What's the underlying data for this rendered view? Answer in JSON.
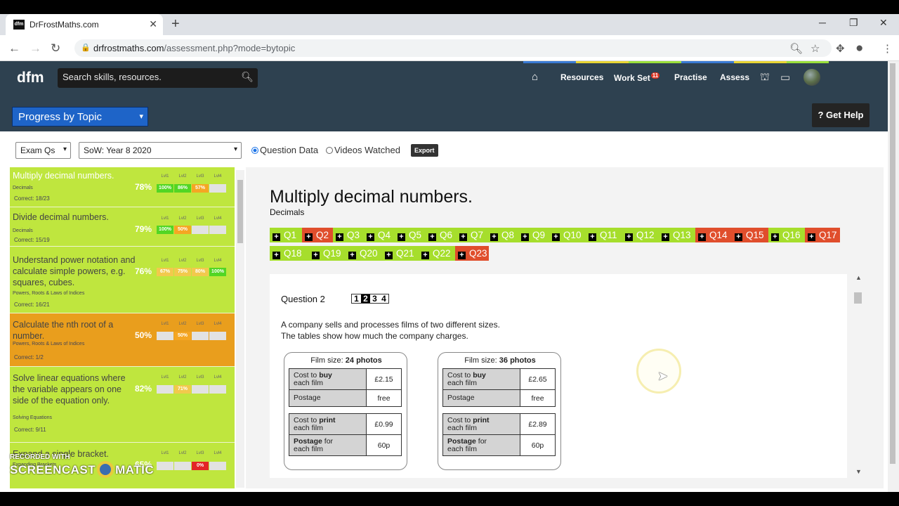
{
  "browser": {
    "tab_title": "DrFrostMaths.com",
    "tab_favicon": "dfm",
    "new_tab": "+",
    "url_host": "drfrostmaths.com",
    "url_path": "/assessment.php?mode=bytopic"
  },
  "header": {
    "logo": "dfm",
    "search_placeholder": "Search skills, resources.",
    "nav": {
      "resources": "Resources",
      "workset": "Work Set",
      "workset_badge": "11",
      "practise": "Practise",
      "assess": "Assess"
    },
    "view_select": "Progress by Topic",
    "get_help": "? Get Help"
  },
  "toolbar": {
    "type_select": "Exam Qs",
    "sow_select": "SoW: Year 8 2020",
    "radio_question_data": "Question Data",
    "radio_videos": "Videos Watched",
    "export": "Export"
  },
  "level_headers": [
    "Lvl1",
    "Lvl2",
    "Lvl3",
    "Lvl4"
  ],
  "topics": [
    {
      "name": "Multiply decimal numbers.",
      "category": "Decimals",
      "correct": "Correct: 18/23",
      "percent": "78%",
      "levels": [
        "100%",
        "86%",
        "57%",
        ""
      ]
    },
    {
      "name": "Divide decimal numbers.",
      "category": "Decimals",
      "correct": "Correct: 15/19",
      "percent": "79%",
      "levels": [
        "100%",
        "50%",
        "",
        ""
      ]
    },
    {
      "name": "Understand power notation and calculate simple powers, e.g. squares, cubes.",
      "category": "Powers, Roots & Laws of Indices",
      "correct": "Correct: 16/21",
      "percent": "76%",
      "levels": [
        "67%",
        "75%",
        "80%",
        "100%"
      ]
    },
    {
      "name": "Calculate the nth root of a number.",
      "category": "Powers, Roots & Laws of Indices",
      "correct": "Correct: 1/2",
      "percent": "50%",
      "levels": [
        "",
        "50%",
        "",
        ""
      ]
    },
    {
      "name": "Solve linear equations where the variable appears on one side of the equation only.",
      "category": "Solving Equations",
      "correct": "Correct: 9/11",
      "percent": "82%",
      "levels": [
        "",
        "71%",
        "",
        ""
      ]
    },
    {
      "name": "Expand a single bracket.",
      "category": "Expanding Brackets",
      "correct": "",
      "percent": "65%",
      "levels": [
        "",
        "",
        "0%",
        ""
      ]
    }
  ],
  "watermark": {
    "line1": "RECORDED WITH",
    "line2a": "SCREENCAST",
    "line2b": "MATIC"
  },
  "main": {
    "title": "Multiply decimal numbers.",
    "category": "Decimals",
    "questions": [
      {
        "label": "Q1",
        "state": "correct"
      },
      {
        "label": "Q2",
        "state": "wrong"
      },
      {
        "label": "Q3",
        "state": "correct"
      },
      {
        "label": "Q4",
        "state": "correct"
      },
      {
        "label": "Q5",
        "state": "correct"
      },
      {
        "label": "Q6",
        "state": "correct"
      },
      {
        "label": "Q7",
        "state": "correct"
      },
      {
        "label": "Q8",
        "state": "correct"
      },
      {
        "label": "Q9",
        "state": "correct"
      },
      {
        "label": "Q10",
        "state": "correct"
      },
      {
        "label": "Q11",
        "state": "correct"
      },
      {
        "label": "Q12",
        "state": "correct"
      },
      {
        "label": "Q13",
        "state": "correct"
      },
      {
        "label": "Q14",
        "state": "wrong"
      },
      {
        "label": "Q15",
        "state": "wrong"
      },
      {
        "label": "Q16",
        "state": "correct"
      },
      {
        "label": "Q17",
        "state": "wrong"
      },
      {
        "label": "Q18",
        "state": "correct"
      },
      {
        "label": "Q19",
        "state": "correct"
      },
      {
        "label": "Q20",
        "state": "correct"
      },
      {
        "label": "Q21",
        "state": "correct"
      },
      {
        "label": "Q22",
        "state": "correct"
      },
      {
        "label": "Q23",
        "state": "wrong"
      }
    ],
    "question": {
      "label": "Question 2",
      "parts": [
        "1",
        "2",
        "3",
        "4"
      ],
      "current_part": "2",
      "text_line1": "A company sells and processes films of two different sizes.",
      "text_line2": "The tables show how much the company charges.",
      "films": [
        {
          "size_label": "Film size:",
          "size": "24 photos",
          "buy": "£2.15",
          "postage": "free",
          "print": "£0.99",
          "print_postage": "60p"
        },
        {
          "size_label": "Film size:",
          "size": "36 photos",
          "buy": "£2.65",
          "postage": "free",
          "print": "£2.89",
          "print_postage": "60p"
        }
      ],
      "row_labels": {
        "buy_a": "Cost to ",
        "buy_b": "buy",
        "buy_c": "each film",
        "postage": "Postage",
        "print_a": "Cost to ",
        "print_b": "print",
        "print_c": "each film",
        "pp_a": "Postage",
        "pp_b": " for",
        "pp_c": "each film"
      }
    }
  },
  "colors": {
    "header": "#2e4150",
    "good": "#bfe63e",
    "warn": "#e99e1d",
    "correct_q": "#a6de2c",
    "wrong_q": "#e04e2c",
    "select_blue": "#1e64c8"
  }
}
